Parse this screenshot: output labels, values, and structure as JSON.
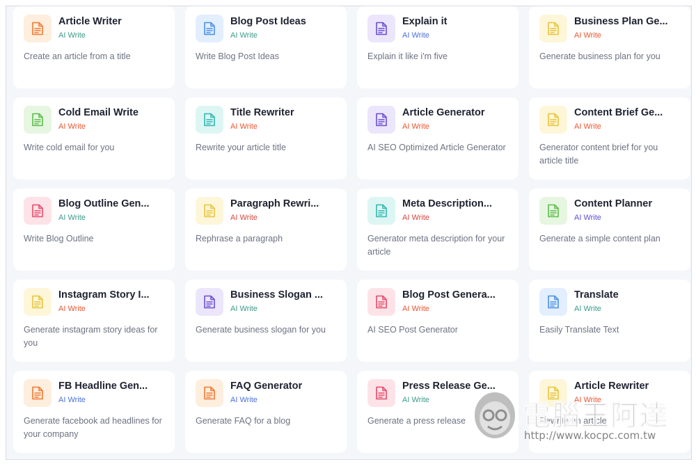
{
  "cards": [
    {
      "title": "Article Writer",
      "tag": "AI Write",
      "desc": "Create an article from a title",
      "icon": "document-icon",
      "color": "#f07a34",
      "bg": "#fdeede",
      "tag_color": "#3a9a8a"
    },
    {
      "title": "Blog Post Ideas",
      "tag": "AI Write",
      "desc": "Write Blog Post Ideas",
      "icon": "document-icon",
      "color": "#4a8fe7",
      "bg": "#e3efff",
      "tag_color": "#3a9a8a"
    },
    {
      "title": "Explain it",
      "tag": "AI Write",
      "desc": "Explain it like i'm five",
      "icon": "document-icon",
      "color": "#6b4fd3",
      "bg": "#ebe6fb",
      "tag_color": "#4a6fd8"
    },
    {
      "title": "Business Plan Ge...",
      "tag": "AI Write",
      "desc": "Generate business plan for you",
      "icon": "document-icon",
      "color": "#e9c43c",
      "bg": "#fdf6d9",
      "tag_color": "#e8552f"
    },
    {
      "title": "Cold Email Write",
      "tag": "AI Write",
      "desc": "Write cold email for you",
      "icon": "document-icon",
      "color": "#5dbb4a",
      "bg": "#e6f6e1",
      "tag_color": "#e8552f"
    },
    {
      "title": "Title Rewriter",
      "tag": "AI Write",
      "desc": "Rewrite your article title",
      "icon": "document-icon",
      "color": "#2fb7b0",
      "bg": "#ddf6f4",
      "tag_color": "#e8552f"
    },
    {
      "title": "Article Generator",
      "tag": "AI Write",
      "desc": "AI SEO Optimized Article Generator",
      "icon": "document-icon",
      "color": "#6b4fd3",
      "bg": "#ebe6fb",
      "tag_color": "#e8552f"
    },
    {
      "title": "Content Brief Ge...",
      "tag": "AI Write",
      "desc": "Generator content brief for you article title",
      "icon": "document-icon",
      "color": "#e9c43c",
      "bg": "#fdf6d9",
      "tag_color": "#e8552f"
    },
    {
      "title": "Blog Outline Gen...",
      "tag": "AI Write",
      "desc": "Write Blog Outline",
      "icon": "document-icon",
      "color": "#e84a6a",
      "bg": "#fde3e8",
      "tag_color": "#3a9a8a"
    },
    {
      "title": "Paragraph Rewri...",
      "tag": "AI Write",
      "desc": "Rephrase a paragraph",
      "icon": "document-icon",
      "color": "#e9c43c",
      "bg": "#fdf6d9",
      "tag_color": "#d8453c"
    },
    {
      "title": "Meta Description...",
      "tag": "AI Write",
      "desc": "Generator meta description for your article",
      "icon": "document-icon",
      "color": "#2fb7b0",
      "bg": "#ddf6f4",
      "tag_color": "#d8453c"
    },
    {
      "title": "Content Planner",
      "tag": "AI Write",
      "desc": "Generate a simple content plan",
      "icon": "document-icon",
      "color": "#5dbb4a",
      "bg": "#e6f6e1",
      "tag_color": "#5a4fd3"
    },
    {
      "title": "Instagram Story I...",
      "tag": "AI Write",
      "desc": "Generate instagram story ideas for you",
      "icon": "document-icon",
      "color": "#e9c43c",
      "bg": "#fdf6d9",
      "tag_color": "#e8552f"
    },
    {
      "title": "Business Slogan ...",
      "tag": "AI Write",
      "desc": "Generate business slogan for you",
      "icon": "document-icon",
      "color": "#6b4fd3",
      "bg": "#ebe6fb",
      "tag_color": "#3a9a8a"
    },
    {
      "title": "Blog Post Genera...",
      "tag": "AI Write",
      "desc": "AI SEO Post Generator",
      "icon": "document-icon",
      "color": "#e84a6a",
      "bg": "#fde3e8",
      "tag_color": "#e8552f"
    },
    {
      "title": "Translate",
      "tag": "AI Write",
      "desc": "Easily Translate Text",
      "icon": "document-icon",
      "color": "#4a8fe7",
      "bg": "#e3efff",
      "tag_color": "#3a9a8a"
    },
    {
      "title": "FB Headline Gen...",
      "tag": "AI Write",
      "desc": "Generate facebook ad headlines for your company",
      "icon": "document-icon",
      "color": "#f07a34",
      "bg": "#fdeede",
      "tag_color": "#4a6fd8"
    },
    {
      "title": "FAQ Generator",
      "tag": "AI Write",
      "desc": "Generate FAQ for a blog",
      "icon": "document-icon",
      "color": "#f07a34",
      "bg": "#fdeede",
      "tag_color": "#4a6fd8"
    },
    {
      "title": "Press Release Ge...",
      "tag": "AI Write",
      "desc": "Generate a press release",
      "icon": "document-icon",
      "color": "#e84a6a",
      "bg": "#fde3e8",
      "tag_color": "#3a9a8a"
    },
    {
      "title": "Article Rewriter",
      "tag": "AI Write",
      "desc": "Rewrite an article",
      "icon": "document-icon",
      "color": "#e9c43c",
      "bg": "#fdf6d9",
      "tag_color": "#e8552f"
    }
  ],
  "watermark": {
    "text": "電腦王阿達",
    "url": "http://www.kocpc.com.tw"
  }
}
